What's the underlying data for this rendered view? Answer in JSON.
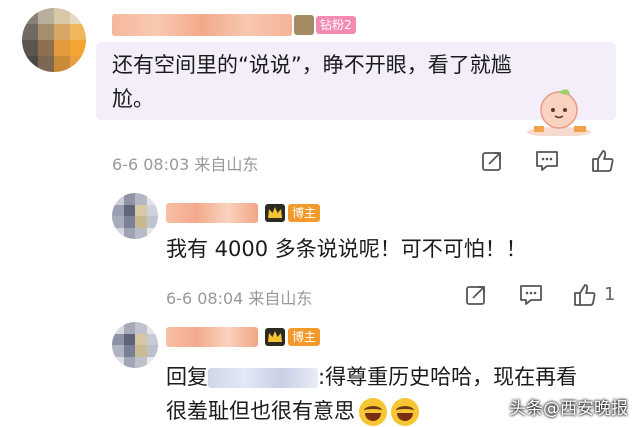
{
  "comments": [
    {
      "badge": "钻粉2",
      "text_line1": "还有空间里的“说说”，睁不开眼，看了就尴",
      "text_line2": "尬。",
      "time": "6-6 08:03 来自山东"
    },
    {
      "badge": "博主",
      "text": "我有 4000 多条说说呢！可不可怕！！",
      "time": "6-6 08:04 来自山东",
      "like_count": "1"
    },
    {
      "badge": "博主",
      "reply_prefix": "回复",
      "text_line1_rest": ":得尊重历史哈哈，现在再看",
      "text_line2": "很羞耻但也很有意思",
      "emojis": [
        "laughing-tears-emoji",
        "laughing-tears-emoji"
      ]
    }
  ],
  "icons": [
    "share-icon",
    "comment-icon",
    "like-icon",
    "crown-icon",
    "diamond-icon"
  ],
  "watermark": "头条@西安晚报",
  "colors": {
    "badge_fan": "#f28ab4",
    "badge_author": "#f39a2d",
    "bubble_bg": "#f4eefb",
    "meta_text": "#999999"
  }
}
